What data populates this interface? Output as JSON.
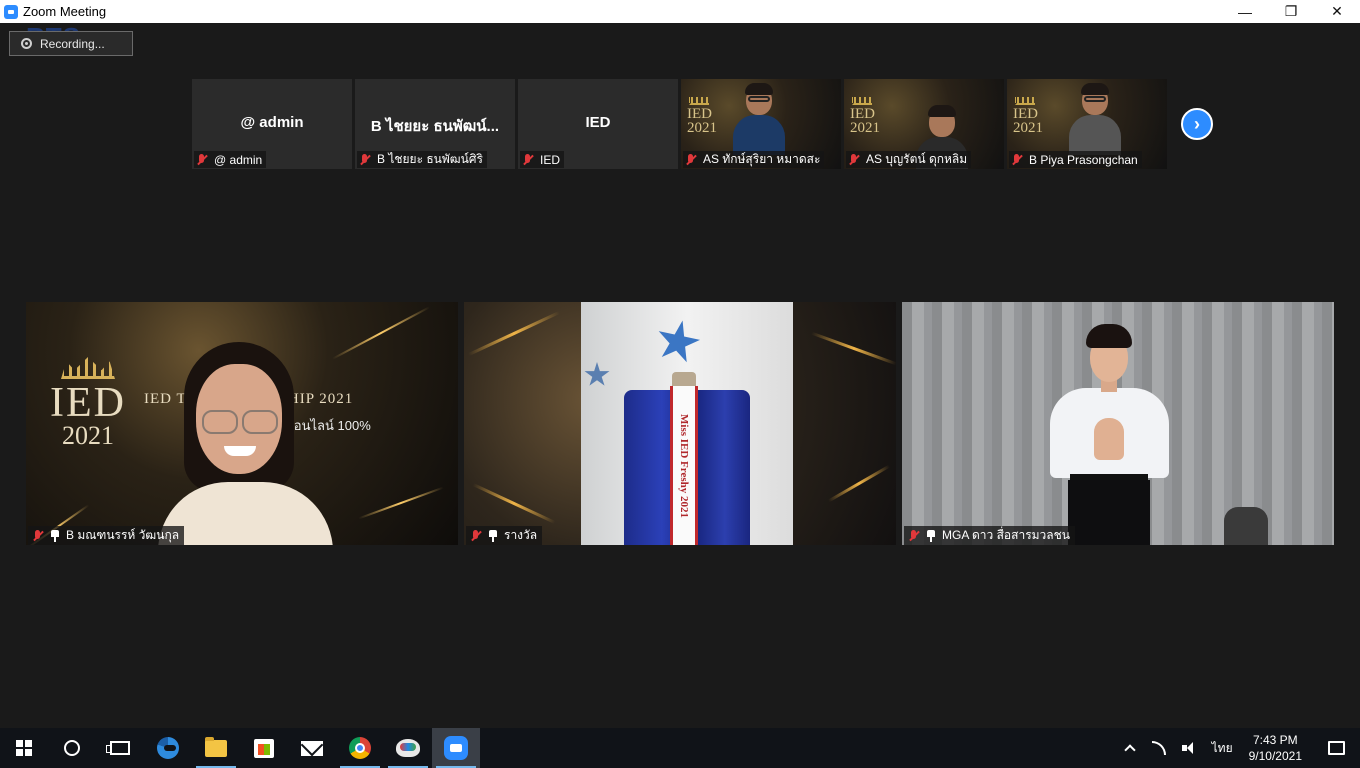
{
  "window": {
    "title": "Zoom Meeting",
    "minimize": "—",
    "maximize": "❐",
    "close": "✕"
  },
  "recording": {
    "label": "Recording..."
  },
  "logo": {
    "text": "RTS"
  },
  "thumbnails": [
    {
      "center_name": "@ admin",
      "label": "@ admin",
      "muted": true,
      "has_video": false
    },
    {
      "center_name": "B ไชยยะ ธนพัฒน์...",
      "label": "B ไชยยะ ธนพัฒน์ศิริ",
      "muted": true,
      "has_video": false
    },
    {
      "center_name": "IED",
      "label": "IED",
      "muted": true,
      "has_video": false
    },
    {
      "center_name": "",
      "label": "AS ทักษ์สุริยา  หมาดสะ",
      "muted": true,
      "has_video": true
    },
    {
      "center_name": "",
      "label": "AS บุญรัตน์ ดุกหลิม",
      "muted": true,
      "has_video": true
    },
    {
      "center_name": "",
      "label": "B Piya Prasongchan",
      "muted": true,
      "has_video": true
    }
  ],
  "thumb_video_text": {
    "ied": "IED",
    "year": "2021"
  },
  "gallery": [
    {
      "label": "B มณฑนรรห์ วัฒนกุล",
      "muted": true,
      "pinned": true,
      "ied_title": "IED",
      "ied_year": "2021",
      "banner": "IED                      THE LEADERSHIP 2021",
      "online": "ออนไลน์ 100%"
    },
    {
      "label": "รางวัล",
      "muted": true,
      "pinned": true,
      "sash_text": "Miss IED Freshy 2021"
    },
    {
      "label": "MGA ดาว สื่อสารมวลชน",
      "muted": true,
      "pinned": true
    }
  ],
  "next_page_button": "›",
  "taskbar": {
    "apps": [
      "start",
      "search",
      "task-view",
      "edge",
      "file-explorer",
      "store",
      "mail",
      "chrome",
      "paint",
      "zoom"
    ],
    "language": "ไทย",
    "time": "7:43 PM",
    "date": "9/10/2021"
  },
  "colors": {
    "zoom_blue": "#2d8cff",
    "mute_red": "#e0383b",
    "background": "#1a1a1a"
  }
}
